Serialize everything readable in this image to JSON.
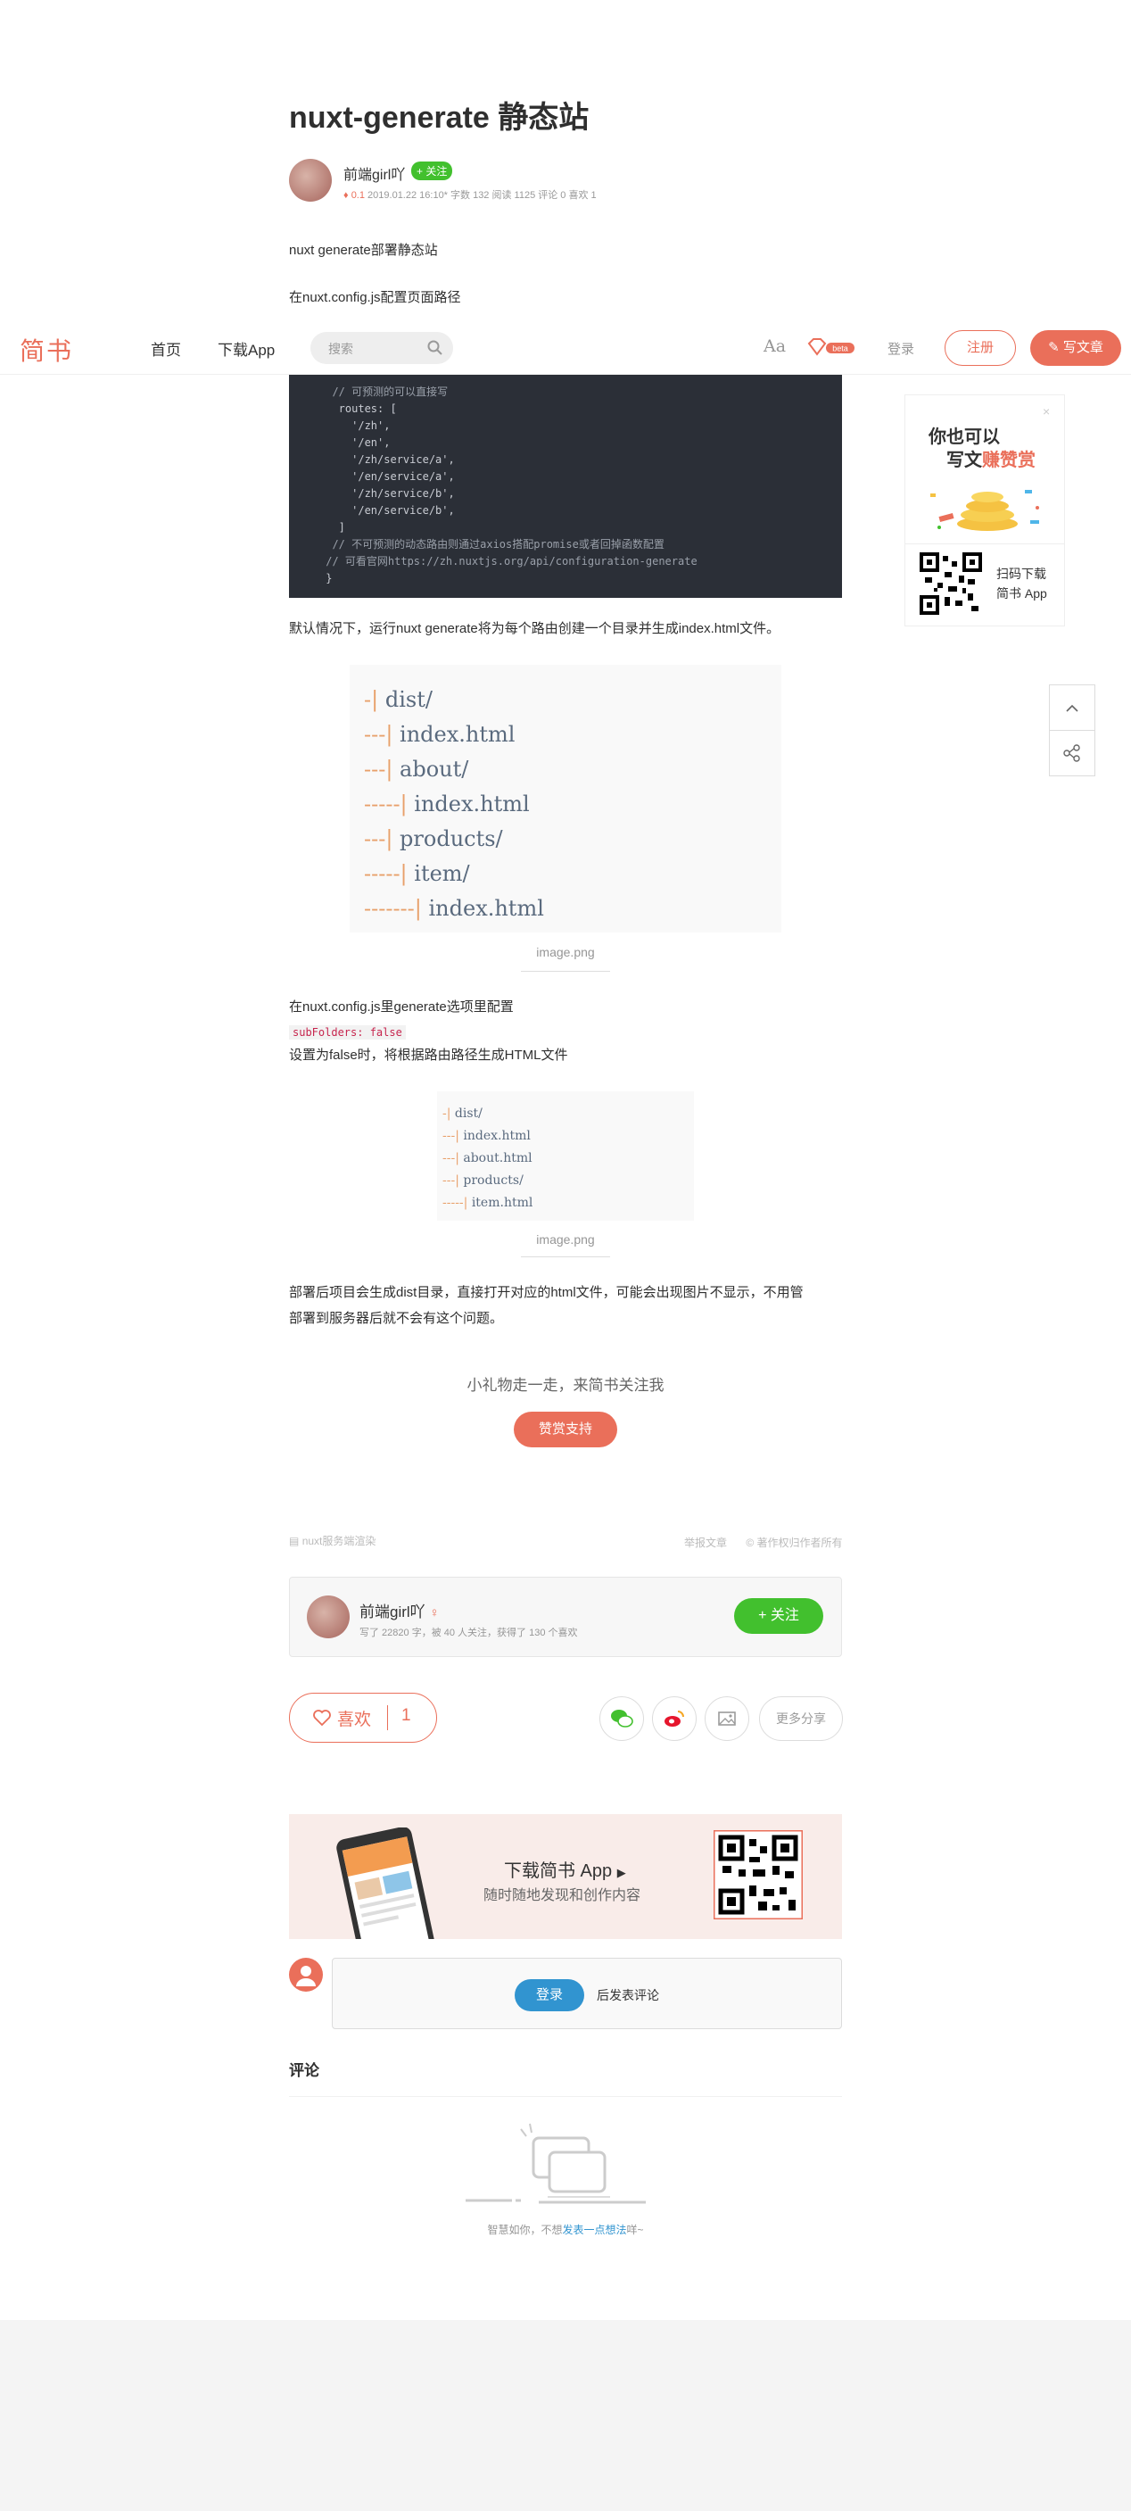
{
  "article": {
    "title": "nuxt-generate 静态站",
    "author": {
      "name": "前端girl吖",
      "follow_label": "+ 关注",
      "diamond": "0.1",
      "meta": "2019.01.22 16:10*  字数 132  阅读 1125 评论 0 喜欢 1"
    },
    "intro": "nuxt generate部署静态站",
    "config_line": "在nuxt.config.js配置页面路径",
    "code_lines": [
      "  // 可预测的可以直接写",
      "   routes: [",
      "     '/zh',",
      "     '/en',",
      "     '/zh/service/a',",
      "     '/en/service/a',",
      "     '/zh/service/b',",
      "     '/en/service/b',",
      "   ]",
      "  // 不可预测的动态路由则通过axios搭配promise或者回掉函数配置",
      " // 可看官网https://zh.nuxtjs.org/api/configuration-generate",
      " }"
    ],
    "default_text": "默认情况下，运行nuxt generate将为每个路由创建一个目录并生成index.html文件。",
    "image1_lines": [
      {
        "bar": "-|",
        "text": " dist/"
      },
      {
        "bar": "---|",
        "text": " index.html"
      },
      {
        "bar": "---|",
        "text": " about/"
      },
      {
        "bar": "-----|",
        "text": " index.html"
      },
      {
        "bar": "---|",
        "text": " products/"
      },
      {
        "bar": "-----|",
        "text": " item/"
      },
      {
        "bar": "-------|",
        "text": " index.html"
      }
    ],
    "image_caption": "image.png",
    "generate_text": "在nuxt.config.js里generate选项里配置",
    "inline_code": "subFolders:  false",
    "false_text": "设置为false时，将根据路由路径生成HTML文件",
    "image2_lines": [
      {
        "bar": "-|",
        "text": " dist/"
      },
      {
        "bar": "---|",
        "text": " index.html"
      },
      {
        "bar": "---|",
        "text": " about.html"
      },
      {
        "bar": "---|",
        "text": " products/"
      },
      {
        "bar": "-----|",
        "text": " item.html"
      }
    ],
    "deploy_text_1": "部署后项目会生成dist目录，直接打开对应的html文件，可能会出现图片不显示，不用管",
    "deploy_text_2": "部署到服务器后就不会有这个问题。"
  },
  "navbar": {
    "logo": "简书",
    "home": "首页",
    "download": "下载App",
    "search_placeholder": "搜索",
    "aa": "Aa",
    "beta": "beta",
    "login": "登录",
    "register": "注册",
    "write": "写文章"
  },
  "side_ad": {
    "line1": "你也可以",
    "line2_a": "写文",
    "line2_b": "赚赞赏",
    "scan1": "扫码下载",
    "scan2": "简书 App"
  },
  "reward": {
    "text": "小礼物走一走，来简书关注我",
    "button": "赞赏支持"
  },
  "footer_meta": {
    "collection": "nuxt服务端渲染",
    "report": "举报文章",
    "copyright": "© 著作权归作者所有"
  },
  "author_card": {
    "name": "前端girl吖",
    "sub": "写了 22820 字，被 40 人关注，获得了 130 个喜欢",
    "follow": "+ 关注"
  },
  "actions": {
    "like": "喜欢",
    "like_count": "1",
    "more_share": "更多分享"
  },
  "banner": {
    "title": "下载简书 App",
    "sub": "随时随地发现和创作内容"
  },
  "comment": {
    "login": "登录",
    "after": "后发表评论",
    "heading": "评论",
    "empty_a": "智慧如你，不想",
    "empty_link": "发表一点想法",
    "empty_b": "咩~"
  },
  "colors": {
    "brand": "#ea6f5a",
    "green": "#42c02e",
    "blue": "#3194d0"
  }
}
